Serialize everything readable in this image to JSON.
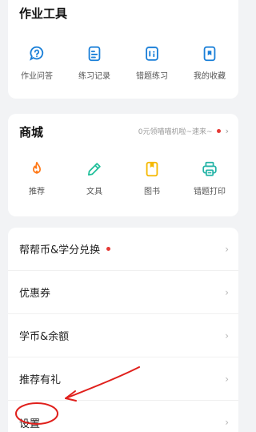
{
  "tools": {
    "title": "作业工具",
    "items": [
      {
        "label": "作业问答",
        "icon": "question-bubble-icon"
      },
      {
        "label": "练习记录",
        "icon": "practice-record-icon"
      },
      {
        "label": "错题练习",
        "icon": "wrong-question-icon"
      },
      {
        "label": "我的收藏",
        "icon": "bookmark-icon"
      }
    ]
  },
  "shop": {
    "title": "商城",
    "promo": "0元领喵喵机啦~速来~",
    "items": [
      {
        "label": "推荐",
        "icon": "flame-icon"
      },
      {
        "label": "文具",
        "icon": "pencil-icon"
      },
      {
        "label": "图书",
        "icon": "book-icon"
      },
      {
        "label": "错题打印",
        "icon": "printer-icon"
      }
    ]
  },
  "menu": {
    "items": [
      {
        "label": "帮帮币&学分兑换"
      },
      {
        "label": "优惠券"
      },
      {
        "label": "学币&余额"
      },
      {
        "label": "推荐有礼"
      },
      {
        "label": "设置"
      }
    ]
  },
  "colors": {
    "tools_icon": "#1a7fd8",
    "shop_flame": "#ff7a1a",
    "shop_pencil": "#1fbf9a",
    "shop_book": "#f5b800",
    "shop_printer": "#22b3a6",
    "badge_red": "#e53935",
    "annotation_red": "#e0201c"
  }
}
